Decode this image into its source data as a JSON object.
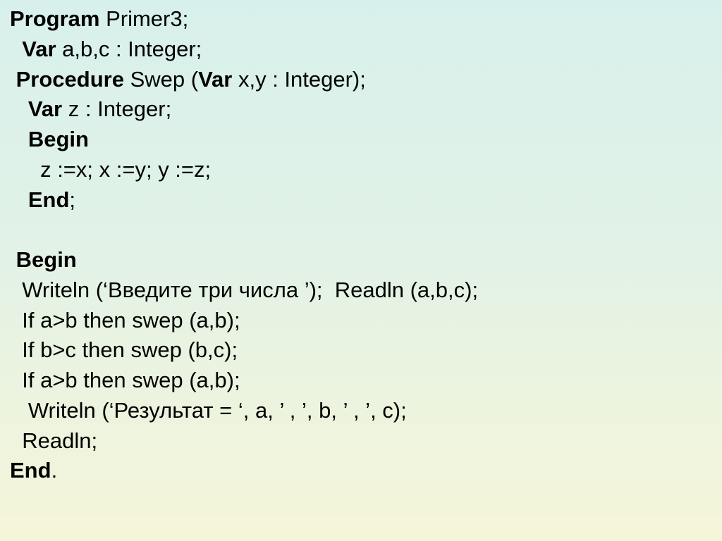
{
  "lines": [
    {
      "indent": "",
      "parts": [
        {
          "t": "Program",
          "b": true
        },
        {
          "t": " Primer3;",
          "b": false
        }
      ]
    },
    {
      "indent": "  ",
      "parts": [
        {
          "t": "Var",
          "b": true
        },
        {
          "t": " a,b,c : Integer;",
          "b": false
        }
      ]
    },
    {
      "indent": " ",
      "parts": [
        {
          "t": "Procedure",
          "b": true
        },
        {
          "t": " Swep (",
          "b": false
        },
        {
          "t": "Var",
          "b": true
        },
        {
          "t": " x,y : Integer);",
          "b": false
        }
      ]
    },
    {
      "indent": "   ",
      "parts": [
        {
          "t": "Var",
          "b": true
        },
        {
          "t": " z : Integer;",
          "b": false
        }
      ]
    },
    {
      "indent": "   ",
      "parts": [
        {
          "t": "Begin",
          "b": true
        }
      ]
    },
    {
      "indent": "     ",
      "parts": [
        {
          "t": "z :=x; x :=y; y :=z;",
          "b": false
        }
      ]
    },
    {
      "indent": "   ",
      "parts": [
        {
          "t": "End",
          "b": true
        },
        {
          "t": ";",
          "b": false
        }
      ]
    },
    {
      "indent": "",
      "parts": [
        {
          "t": " ",
          "b": false
        }
      ]
    },
    {
      "indent": " ",
      "parts": [
        {
          "t": "Begin",
          "b": true
        }
      ]
    },
    {
      "indent": "  ",
      "parts": [
        {
          "t": "Writeln (‘Введите три числа ’);  Readln (a,b,c);",
          "b": false
        }
      ]
    },
    {
      "indent": "  ",
      "parts": [
        {
          "t": "If a>b then swep (a,b);",
          "b": false
        }
      ]
    },
    {
      "indent": "  ",
      "parts": [
        {
          "t": "If b>c then swep (b,c);",
          "b": false
        }
      ]
    },
    {
      "indent": "  ",
      "parts": [
        {
          "t": "If a>b then swep (a,b);",
          "b": false
        }
      ]
    },
    {
      "indent": "   ",
      "parts": [
        {
          "t": "Writeln (‘Результат = ‘, a, ’ , ’, b, ’ , ’, c);",
          "b": false
        }
      ]
    },
    {
      "indent": "  ",
      "parts": [
        {
          "t": "Readln;",
          "b": false
        }
      ]
    },
    {
      "indent": "",
      "parts": [
        {
          "t": "End",
          "b": true
        },
        {
          "t": ".",
          "b": false
        }
      ]
    }
  ]
}
